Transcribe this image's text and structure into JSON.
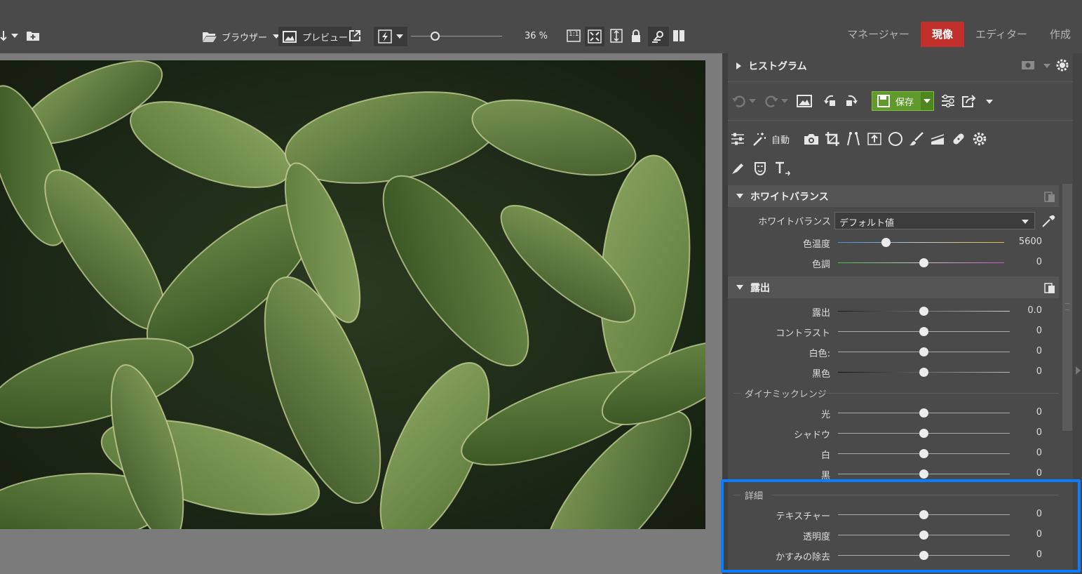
{
  "toolbar": {
    "browser_label": "ブラウザー",
    "preview_label": "プレビュー",
    "zoom_percent": "36 %",
    "zoom_level": 0.36,
    "one_to_one": "1:1"
  },
  "modes": [
    {
      "label": "マネージャー",
      "active": false
    },
    {
      "label": "現像",
      "active": true
    },
    {
      "label": "エディター",
      "active": false
    },
    {
      "label": "作成",
      "active": false
    }
  ],
  "histogram": {
    "title": "ヒストグラム"
  },
  "actions": {
    "save_label": "保存",
    "auto_label": "自動"
  },
  "white_balance": {
    "title": "ホワイトバランス",
    "mode_label": "ホワイトバランス",
    "mode_value": "デフォルト値",
    "rows": [
      {
        "label": "色温度",
        "value": "5600",
        "pos": 0.28
      },
      {
        "label": "色調",
        "value": "0",
        "pos": 0.5
      }
    ]
  },
  "exposure": {
    "title": "露出",
    "rows": [
      {
        "label": "露出",
        "value": "0.0",
        "pos": 0.5
      },
      {
        "label": "コントラスト",
        "value": "0",
        "pos": 0.5
      },
      {
        "label": "白色:",
        "value": "0",
        "pos": 0.5
      },
      {
        "label": "黒色",
        "value": "0",
        "pos": 0.5
      }
    ],
    "dynamic_range": {
      "title": "ダイナミックレンジ",
      "rows": [
        {
          "label": "光",
          "value": "0",
          "pos": 0.5
        },
        {
          "label": "シャドウ",
          "value": "0",
          "pos": 0.5
        },
        {
          "label": "白",
          "value": "0",
          "pos": 0.5
        },
        {
          "label": "黒",
          "value": "0",
          "pos": 0.5
        }
      ]
    },
    "detail": {
      "title": "詳細",
      "rows": [
        {
          "label": "テキスチャー",
          "value": "0",
          "pos": 0.5
        },
        {
          "label": "透明度",
          "value": "0",
          "pos": 0.5
        },
        {
          "label": "かすみの除去",
          "value": "0",
          "pos": 0.5
        }
      ]
    }
  },
  "colors": {
    "accent_active": "#c1302a",
    "save_green": "#5f9a2a",
    "highlight_blue": "#0b7bff"
  }
}
